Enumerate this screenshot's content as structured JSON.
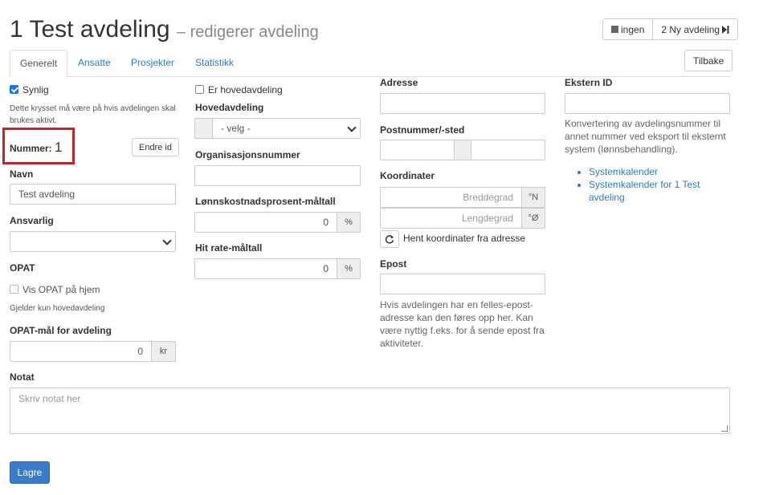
{
  "header": {
    "title": "1 Test avdeling",
    "subtitle": "– redigerer avdeling",
    "nav_prev_label": "ingen",
    "nav_next_label": "2 Ny avdeling",
    "back_label": "Tilbake"
  },
  "tabs": [
    {
      "label": "Generelt",
      "active": true
    },
    {
      "label": "Ansatte",
      "active": false
    },
    {
      "label": "Prosjekter",
      "active": false
    },
    {
      "label": "Statistikk",
      "active": false
    }
  ],
  "col1": {
    "synlig_label": "Synlig",
    "synlig_checked": true,
    "synlig_help_1": "Dette krysset må være på hvis avdelingen skal",
    "synlig_help_2": "brukes aktivt.",
    "nummer_label": "Nummer:",
    "nummer_value": "1",
    "endre_id_label": "Endre id",
    "navn_label": "Navn",
    "navn_value": "Test avdeling",
    "ansvarlig_label": "Ansvarlig",
    "ansvarlig_value": "",
    "opat_label": "OPAT",
    "vis_opat_label": "Vis OPAT på hjem",
    "vis_opat_help": "Gjelder kun hovedavdeling",
    "opat_maal_label": "OPAT-mål for avdeling",
    "opat_maal_value": "0",
    "opat_maal_unit": "kr"
  },
  "col2": {
    "er_hovedavdeling_label": "Er hovedavdeling",
    "hovedavdeling_label": "Hovedavdeling",
    "hovedavdeling_value": "- velg -",
    "orgnr_label": "Organisasjonsnummer",
    "orgnr_value": "",
    "lonn_label": "Lønnskostnadsprosent-måltall",
    "lonn_value": "0",
    "lonn_unit": "%",
    "hitrate_label": "Hit rate-måltall",
    "hitrate_value": "0",
    "hitrate_unit": "%"
  },
  "col3": {
    "adresse_label": "Adresse",
    "postnr_label": "Postnummer/-sted",
    "koordinater_label": "Koordinater",
    "breddegrad_placeholder": "Breddegrad",
    "breddegrad_unit": "°N",
    "lengdegrad_placeholder": "Lengdegrad",
    "lengdegrad_unit": "°Ø",
    "hent_koord_label": "Hent koordinater fra adresse",
    "epost_label": "Epost",
    "epost_help_1": "Hvis avdelingen har en felles-epost-",
    "epost_help_2": "adresse kan den føres opp her. Kan",
    "epost_help_3": "være nyttig f.eks. for å sende epost fra",
    "epost_help_4": "aktiviteter."
  },
  "col4": {
    "ekstern_id_label": "Ekstern ID",
    "ekstern_help_1": "Konvertering av avdelingsnummer til",
    "ekstern_help_2": "annet nummer ved eksport til eksternt",
    "ekstern_help_3": "system (lønnsbehandling).",
    "link_1": "Systemkalender",
    "link_2_line1": "Systemkalender for 1 Test",
    "link_2_line2": "avdeling"
  },
  "notat": {
    "label": "Notat",
    "placeholder": "Skriv notat her"
  },
  "footer": {
    "save_label": "Lagre"
  },
  "colors": {
    "link": "#337ab7",
    "primary_button": "#3a7cc7",
    "highlight_box": "#c0272d"
  }
}
